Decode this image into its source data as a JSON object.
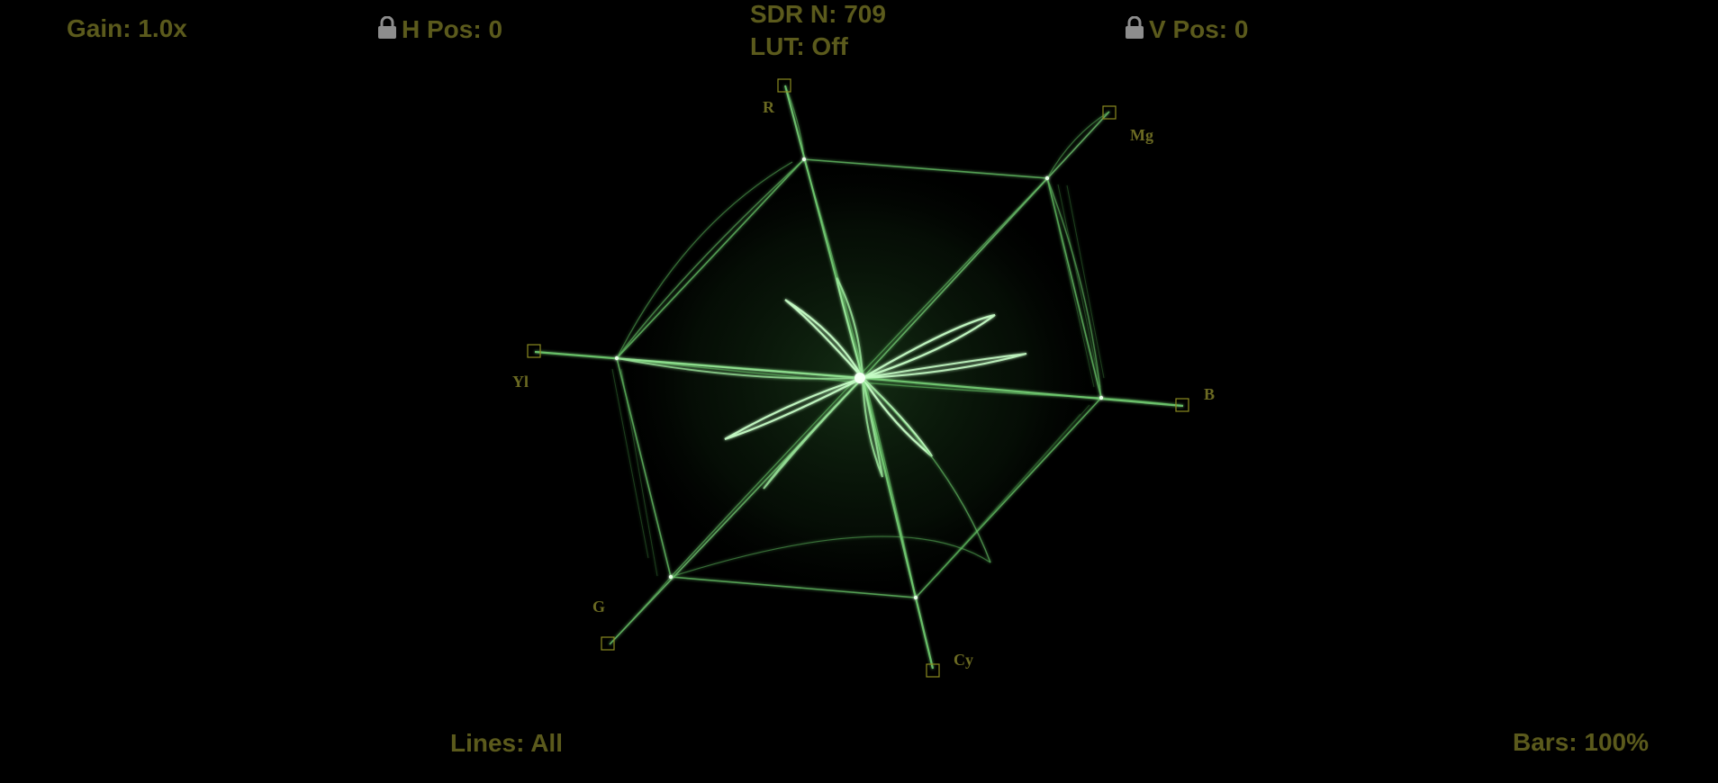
{
  "hud": {
    "gain": "Gain: 1.0x",
    "h_pos": "H Pos: 0",
    "v_pos": "V Pos: 0",
    "standard": "SDR N: 709",
    "lut": "LUT: Off",
    "lines": "Lines: All",
    "bars": "Bars: 100%"
  },
  "targets": {
    "r": "R",
    "mg": "Mg",
    "b": "B",
    "cy": "Cy",
    "g": "G",
    "yl": "Yl"
  },
  "icons": {
    "h_lock": "lock-icon",
    "v_lock": "lock-icon"
  },
  "colors": {
    "hud_text": "#5b5a1c",
    "trace": "#6fd06f",
    "trace_bright": "#e8ffe8",
    "target_box": "#8a8a20"
  }
}
